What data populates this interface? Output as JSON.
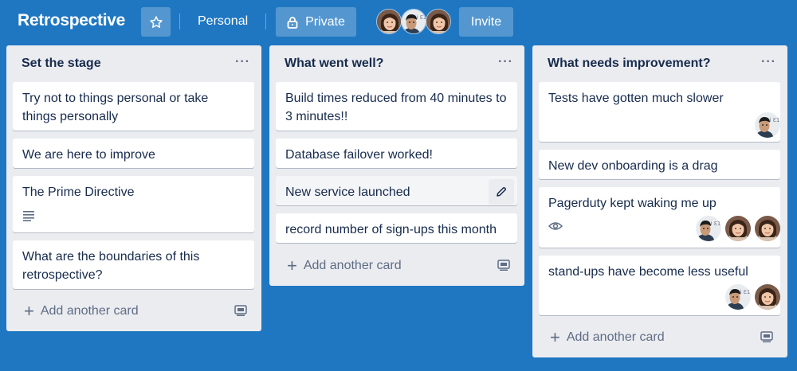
{
  "header": {
    "board_title": "Retrospective",
    "star_icon": "star-icon",
    "visibility_personal": "Personal",
    "visibility_private": "Private",
    "lock_icon": "lock-icon",
    "invite_label": "Invite"
  },
  "lists": [
    {
      "title": "Set the stage",
      "menu": "···",
      "cards": [
        {
          "text": "Try not to things personal or take things personally"
        },
        {
          "text": "We are here to improve"
        },
        {
          "text": "The Prime Directive"
        },
        {
          "text": "What are the boundaries of this retrospective?"
        }
      ],
      "add_label": "Add another card"
    },
    {
      "title": "What went well?",
      "menu": "···",
      "cards": [
        {
          "text": "Build times reduced from 40 minutes to 3 minutes!!"
        },
        {
          "text": "Database failover worked!"
        },
        {
          "text": "New service launched"
        },
        {
          "text": "record number of sign-ups this month"
        }
      ],
      "add_label": "Add another card"
    },
    {
      "title": "What needs improvement?",
      "menu": "···",
      "cards": [
        {
          "text": "Tests have gotten much slower"
        },
        {
          "text": "New dev onboarding is a drag"
        },
        {
          "text": "Pagerduty kept waking me up"
        },
        {
          "text": "stand-ups have become less useful"
        }
      ],
      "add_label": "Add another card"
    }
  ],
  "colors": {
    "board_background": "#1f77c2",
    "list_background": "#ebecf0",
    "card_background": "#ffffff",
    "text_primary": "#172b4d",
    "text_secondary": "#5e6c84"
  }
}
